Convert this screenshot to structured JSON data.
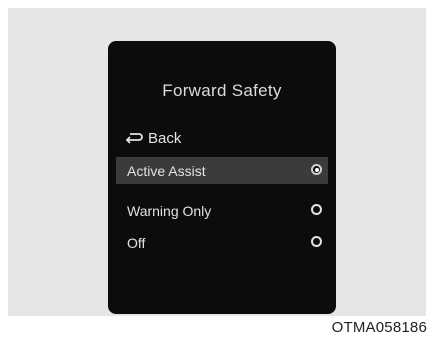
{
  "screen": {
    "title": "Forward Safety",
    "back_label": "Back",
    "options": [
      {
        "label": "Active Assist",
        "selected": true
      },
      {
        "label": "Warning Only",
        "selected": false
      },
      {
        "label": "Off",
        "selected": false
      }
    ]
  },
  "figure_code": "OTMA058186",
  "colors": {
    "screen_background": "#0c0c0c",
    "selected_row": "#3b3b3b",
    "frame_background": "#e6e6e6",
    "text": "#e2e2e2"
  },
  "icons": {
    "back": "back-arrow-icon",
    "radio_on": "radio-selected-icon",
    "radio_off": "radio-unselected-icon"
  }
}
